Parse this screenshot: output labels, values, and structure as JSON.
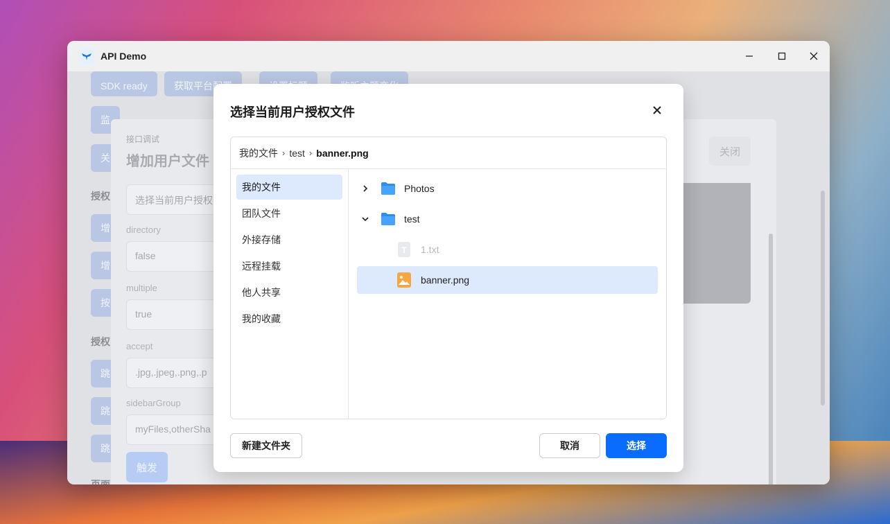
{
  "window": {
    "title": "API Demo"
  },
  "background": {
    "buttons": [
      "SDK ready",
      "获取平台配置",
      "设置标题",
      "监听主题变化",
      "监",
      "关",
      "增",
      "增",
      "按",
      "跳",
      "跳",
      "跳"
    ],
    "labels": [
      "授权",
      "授权",
      "页面路由"
    ],
    "panel": {
      "breadcrumb": "接口调试",
      "title": "增加用户文件",
      "close_label": "关闭",
      "fields": [
        {
          "label": "",
          "value": "选择当前用户授权"
        },
        {
          "label": "directory",
          "value": "false"
        },
        {
          "label": "multiple",
          "value": "true"
        },
        {
          "label": "accept",
          "value": ".jpg,.jpeg,.png,.p"
        },
        {
          "label": "sidebarGroup",
          "value": "myFiles,otherSha"
        }
      ],
      "trigger_label": "触发"
    }
  },
  "dialog": {
    "title": "选择当前用户授权文件",
    "breadcrumb": [
      "我的文件",
      "test",
      "banner.png"
    ],
    "sidebar": [
      {
        "label": "我的文件",
        "active": true
      },
      {
        "label": "团队文件",
        "active": false
      },
      {
        "label": "外接存储",
        "active": false
      },
      {
        "label": "远程挂载",
        "active": false
      },
      {
        "label": "他人共享",
        "active": false
      },
      {
        "label": "我的收藏",
        "active": false
      }
    ],
    "tree": [
      {
        "label": "Photos",
        "type": "folder",
        "expanded": false,
        "depth": 0
      },
      {
        "label": "test",
        "type": "folder",
        "expanded": true,
        "depth": 0
      },
      {
        "label": "1.txt",
        "type": "text-file",
        "disabled": true,
        "depth": 1
      },
      {
        "label": "banner.png",
        "type": "image-file",
        "selected": true,
        "depth": 1
      }
    ],
    "buttons": {
      "new_folder": "新建文件夹",
      "cancel": "取消",
      "select": "选择"
    }
  },
  "colors": {
    "primary": "#0a6cff",
    "selection": "#dde9fc",
    "folder": "#2f8cf5",
    "image_icon": "#f5a640"
  }
}
